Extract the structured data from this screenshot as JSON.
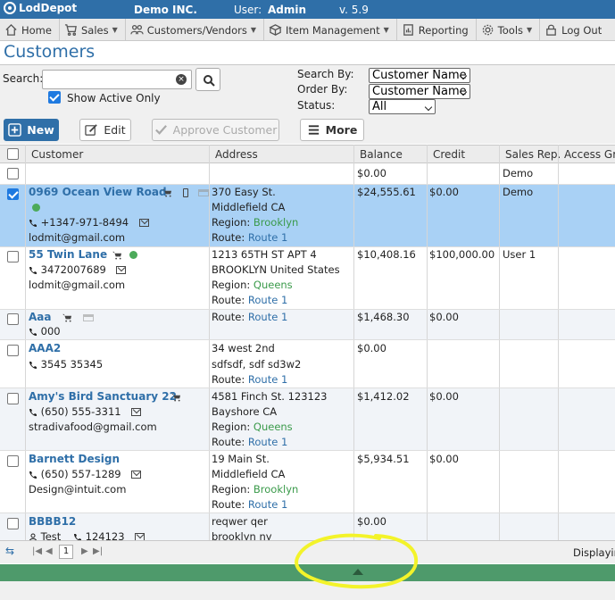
{
  "topbar": {
    "app_name": "LodDepot",
    "company": "Demo INC.",
    "user_label": "User:",
    "user_name": "Admin",
    "version": "v. 5.9"
  },
  "nav": {
    "items": [
      {
        "label": "Home",
        "icon": "home-icon"
      },
      {
        "label": "Sales",
        "icon": "cart-icon",
        "dropdown": true
      },
      {
        "label": "Customers/Vendors",
        "icon": "users-icon",
        "dropdown": true
      },
      {
        "label": "Item Management",
        "icon": "box-icon",
        "dropdown": true
      },
      {
        "label": "Reporting",
        "icon": "report-icon"
      },
      {
        "label": "Tools",
        "icon": "gear-icon",
        "dropdown": true
      },
      {
        "label": "Log Out",
        "icon": "lock-icon"
      }
    ]
  },
  "page": {
    "title": "Customers"
  },
  "filter": {
    "search_label": "Search:",
    "search_value": "",
    "show_active_label": "Show Active Only",
    "search_by_label": "Search By:",
    "search_by_value": "Customer Name",
    "order_by_label": "Order By:",
    "order_by_value": "Customer Name",
    "status_label": "Status:",
    "status_value": "All"
  },
  "toolbar": {
    "new_label": "New",
    "edit_label": "Edit",
    "approve_label": "Approve Customer",
    "more_label": "More"
  },
  "grid": {
    "columns": [
      "Customer",
      "Address",
      "Balance",
      "Credit",
      "Sales Rep.",
      "Access Gro"
    ],
    "summary": {
      "balance": "$0.00",
      "rep": "Demo"
    },
    "rows": [
      {
        "name": "0969 Ocean View Road",
        "phone": "+1347-971-8494",
        "email": "lodmit@gmail.com",
        "addr1": "370 Easy St.",
        "addr2": "Middlefield CA",
        "region_label": "Region:",
        "region": "Brooklyn",
        "route_label": "Route:",
        "route": "Route 1",
        "balance": "$24,555.61",
        "credit": "$0.00",
        "rep": "Demo"
      },
      {
        "name": "55 Twin Lane",
        "phone": "3472007689",
        "email": "lodmit@gmail.com",
        "addr1": "1213 65TH ST APT 4",
        "addr2": "BROOKLYN United States",
        "region_label": "Region:",
        "region": "Queens",
        "route_label": "Route:",
        "route": "Route 1",
        "balance": "$10,408.16",
        "credit": "$100,000.00",
        "rep": "User 1"
      },
      {
        "name": "Aaa",
        "phone": "000",
        "route_label": "Route:",
        "route": "Route 1",
        "balance": "$1,468.30",
        "credit": "$0.00"
      },
      {
        "name": "AAA2",
        "phone": "3545 35345",
        "addr1": "34 west 2nd",
        "addr2": "sdfsdf, sdf sd3w2",
        "route_label": "Route:",
        "route": "Route 1",
        "balance": "$0.00"
      },
      {
        "name": "Amy's Bird Sanctuary 22",
        "phone": "(650) 555-3311",
        "email": "stradivafood@gmail.com",
        "addr1": "4581 Finch St. 123123",
        "addr2": "Bayshore CA",
        "region_label": "Region:",
        "region": "Queens",
        "route_label": "Route:",
        "route": "Route 1",
        "balance": "$1,412.02",
        "credit": "$0.00"
      },
      {
        "name": "Barnett Design",
        "phone": "(650) 557-1289",
        "email": "Design@intuit.com",
        "addr1": "19 Main St.",
        "addr2": "Middlefield CA",
        "region_label": "Region:",
        "region": "Brooklyn",
        "route_label": "Route:",
        "route": "Route 1",
        "balance": "$5,934.51",
        "credit": "$0.00"
      },
      {
        "name": "BBBB12",
        "contact": "Test",
        "phone": "124123",
        "addr1": "reqwer qer",
        "addr2": "brooklyn ny",
        "balance": "$0.00"
      }
    ]
  },
  "pager": {
    "page": "1",
    "display_text": "Displaying"
  }
}
